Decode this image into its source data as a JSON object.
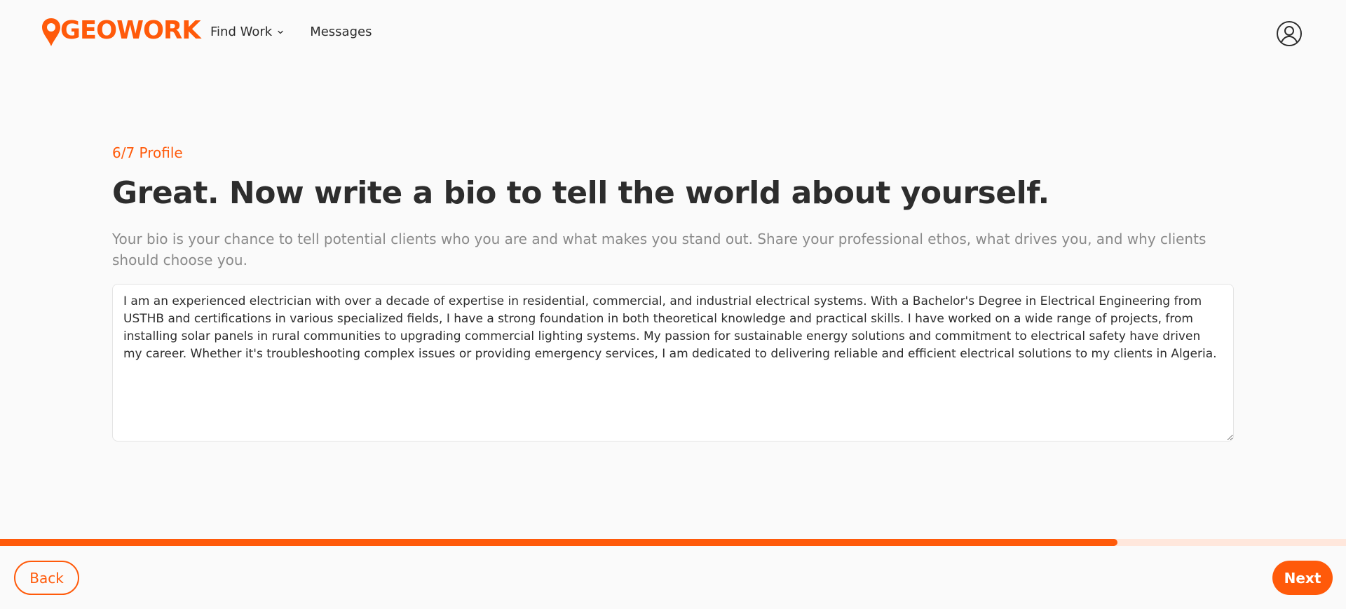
{
  "brand": {
    "logo_text": "GEOWORK",
    "accent_color": "#ff5a0a"
  },
  "nav": {
    "find_work_label": "Find Work",
    "messages_label": "Messages"
  },
  "header": {
    "user_icon": "user-circle-icon"
  },
  "step": {
    "label": "6/7 Profile"
  },
  "page": {
    "title": "Great. Now write a bio to tell the world about yourself.",
    "subtitle": "Your bio is your chance to tell potential clients who you are and what makes you stand out. Share your professional ethos, what drives you, and why clients should choose you."
  },
  "bio": {
    "value": "I am an experienced electrician with over a decade of expertise in residential, commercial, and industrial electrical systems. With a Bachelor's Degree in Electrical Engineering from USTHB and certifications in various specialized fields, I have a strong foundation in both theoretical knowledge and practical skills. I have worked on a wide range of projects, from installing solar panels in rural communities to upgrading commercial lighting systems. My passion for sustainable energy solutions and commitment to electrical safety have driven my career. Whether it's troubleshooting complex issues or providing emergency services, I am dedicated to delivering reliable and efficient electrical solutions to my clients in Algeria."
  },
  "progress": {
    "fraction": 0.83
  },
  "footer": {
    "back_label": "Back",
    "next_label": "Next"
  }
}
